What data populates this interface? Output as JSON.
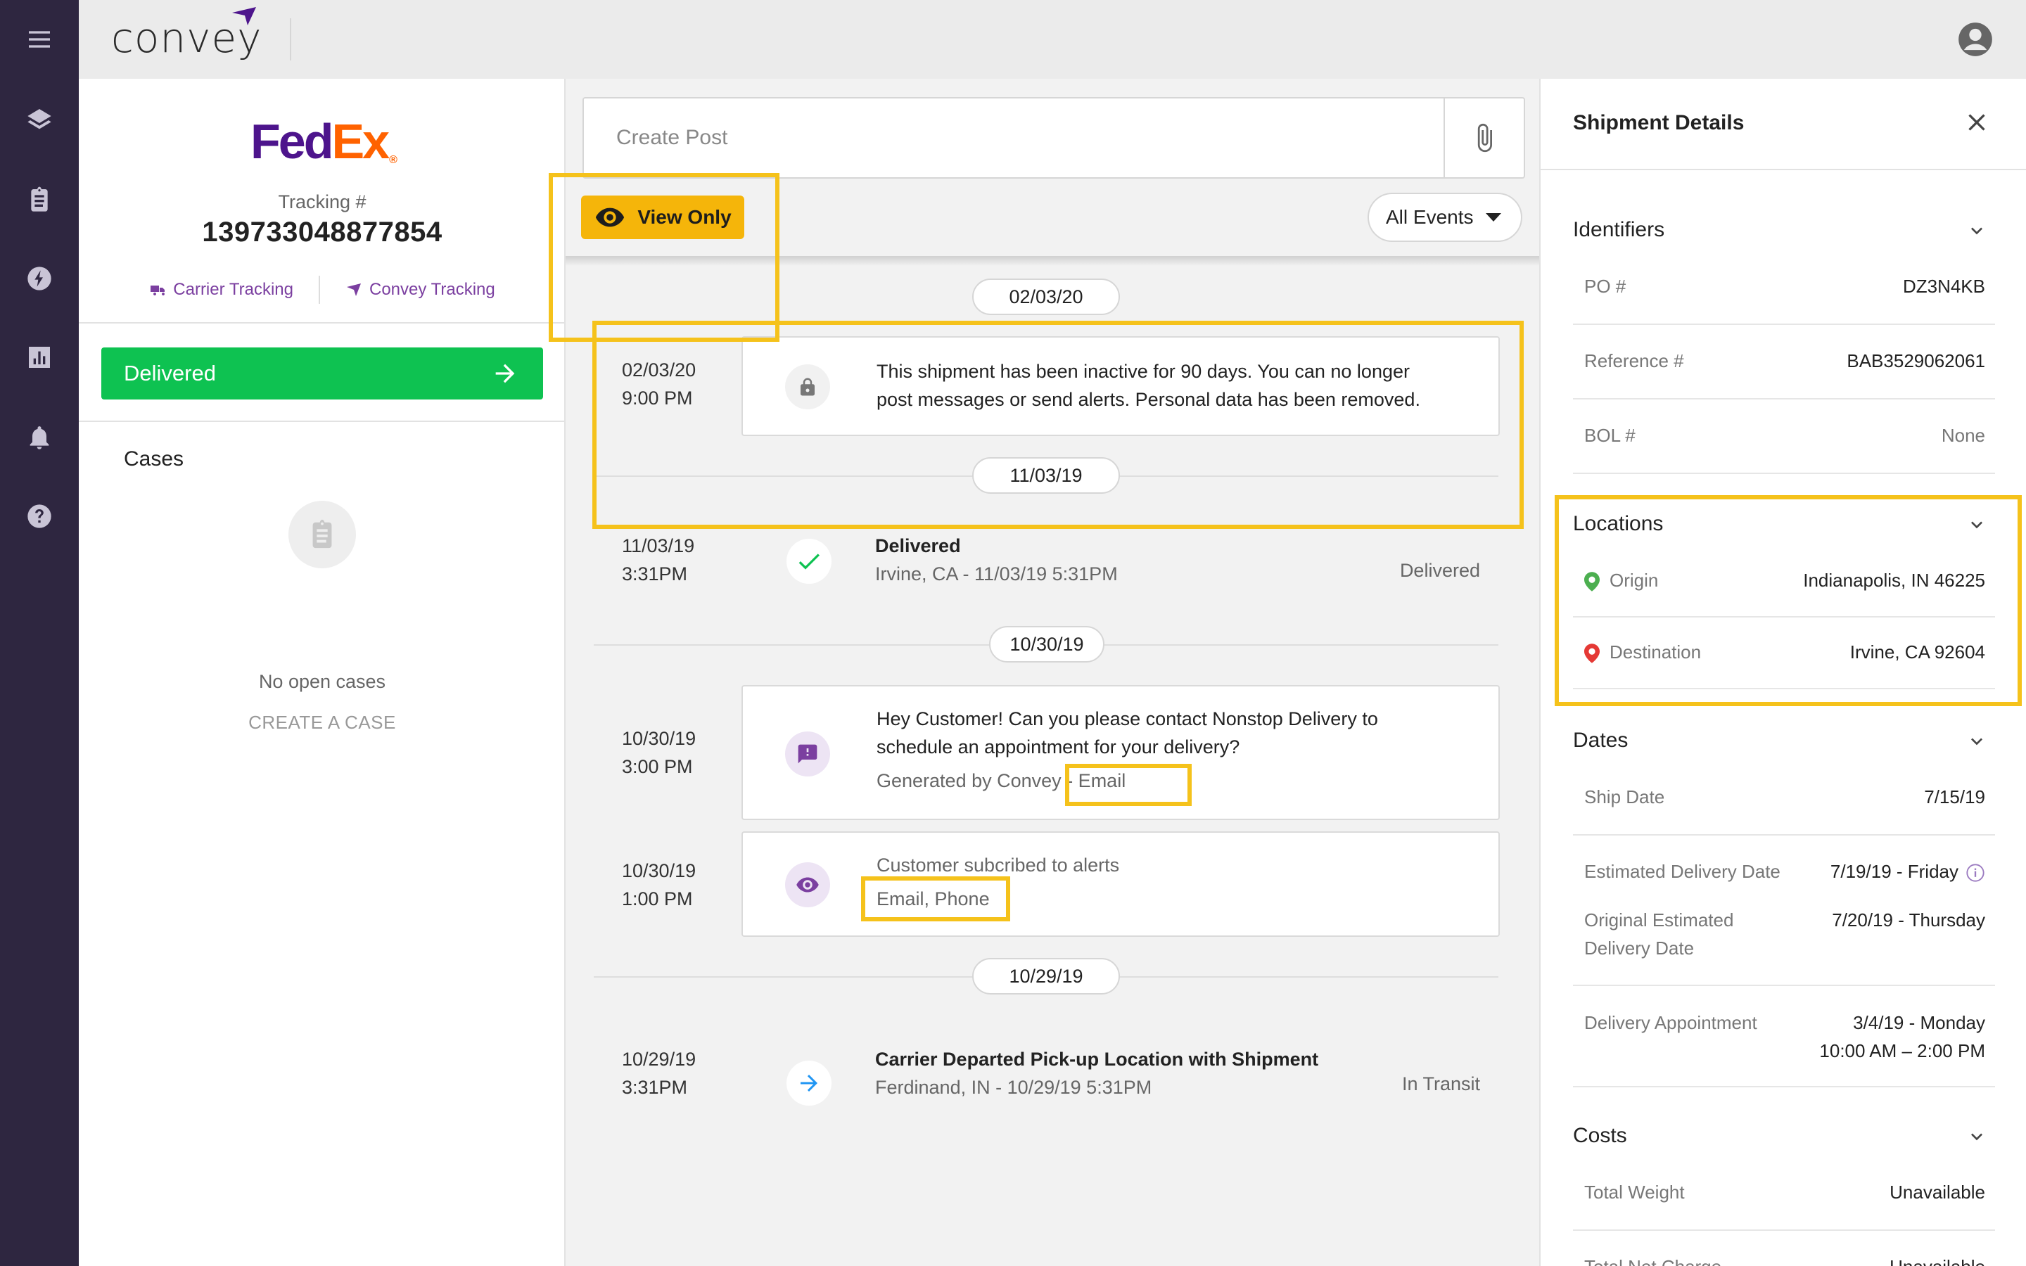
{
  "app": {
    "logo_text": "convey",
    "menu_icon": "menu-icon",
    "account_icon": "account-icon"
  },
  "rail": {
    "icons": [
      "menu-icon",
      "layers-icon",
      "clipboard-icon",
      "bolt-icon",
      "bar-chart-icon",
      "bell-icon",
      "help-icon"
    ]
  },
  "shipment": {
    "carrier_logo_fed": "Fed",
    "carrier_logo_ex": "Ex",
    "carrier_logo_reg": "®",
    "tracking_label": "Tracking #",
    "tracking_number": "139733048877854",
    "carrier_tracking_label": "Carrier Tracking",
    "convey_tracking_label": "Convey Tracking",
    "status_label": "Delivered",
    "status_color": "#0ec251"
  },
  "cases": {
    "title": "Cases",
    "empty_text": "No open cases",
    "create_label": "CREATE A CASE"
  },
  "feed": {
    "post_placeholder": "Create Post",
    "view_only_label": "View Only",
    "filter_label": "All Events",
    "accent_color": "#f5b50a",
    "groups": [
      {
        "date": "02/03/20"
      },
      {
        "date": "11/03/19"
      },
      {
        "date": "10/30/19"
      },
      {
        "date": "10/29/19"
      }
    ],
    "events": [
      {
        "date": "02/03/20",
        "time": "9:00 PM",
        "icon": "lock-icon",
        "line1": "This shipment has been inactive for 90 days. You can no longer",
        "line2": "post messages or send alerts. Personal data has been removed."
      },
      {
        "date": "11/03/19",
        "time": "3:31PM",
        "icon": "check-icon",
        "title": "Delivered",
        "detail": "Irvine, CA - 11/03/19 5:31PM",
        "status": "Delivered"
      },
      {
        "date": "10/30/19",
        "time": "3:00 PM",
        "icon": "message-alert-icon",
        "line1": "Hey Customer! Can you please contact Nonstop Delivery to",
        "line2": "schedule an appointment for your delivery?",
        "generated_by": "Generated by Convey",
        "channel": "- Email"
      },
      {
        "date": "10/30/19",
        "time": "1:00 PM",
        "icon": "eye-icon",
        "line1": "Customer subcribed to alerts",
        "channels": "Email, Phone"
      },
      {
        "date": "10/29/19",
        "time": "3:31PM",
        "icon": "arrow-right-icon",
        "title": "Carrier Departed Pick-up Location with Shipment",
        "detail": "Ferdinand, IN - 10/29/19 5:31PM",
        "status": "In Transit"
      }
    ]
  },
  "details": {
    "title": "Shipment Details",
    "identifiers": {
      "title": "Identifiers",
      "rows": [
        {
          "label": "PO #",
          "value": "DZ3N4KB"
        },
        {
          "label": "Reference #",
          "value": "BAB3529062061"
        },
        {
          "label": "BOL #",
          "value": "None"
        }
      ]
    },
    "locations": {
      "title": "Locations",
      "origin_label": "Origin",
      "origin_value": "Indianapolis, IN 46225",
      "origin_color": "#4caf50",
      "destination_label": "Destination",
      "destination_value": "Irvine, CA 92604",
      "destination_color": "#e53935"
    },
    "dates": {
      "title": "Dates",
      "ship_label": "Ship Date",
      "ship_value": "7/15/19",
      "est_label": "Estimated Delivery Date",
      "est_value": "7/19/19 - Friday",
      "orig_label_1": "Original Estimated",
      "orig_label_2": "Delivery Date",
      "orig_value": "7/20/19 - Thursday",
      "appt_label": "Delivery Appointment",
      "appt_value_1": "3/4/19 - Monday",
      "appt_value_2": "10:00 AM – 2:00 PM"
    },
    "costs": {
      "title": "Costs",
      "weight_label": "Total Weight",
      "weight_value": "Unavailable",
      "net_label": "Total Net Charge",
      "net_value": "Unavailable"
    }
  }
}
